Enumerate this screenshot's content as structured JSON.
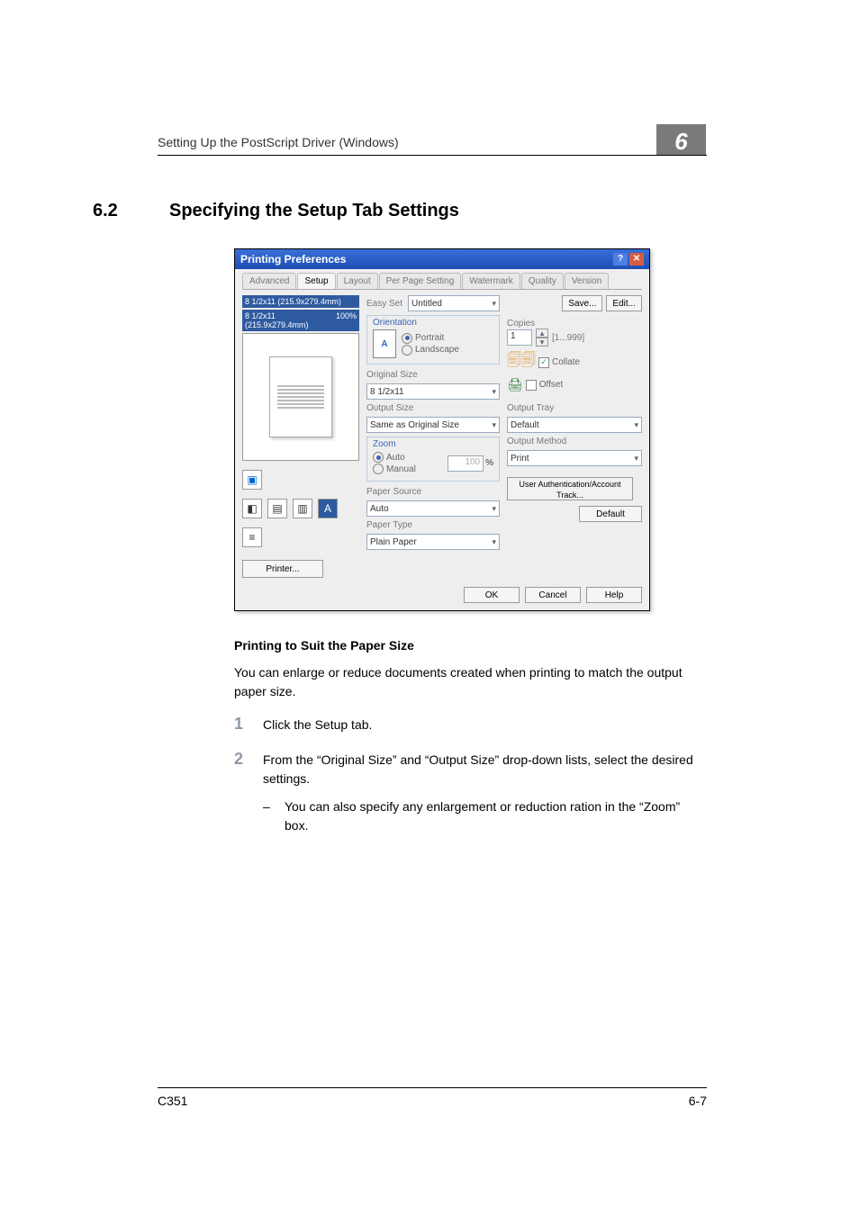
{
  "header": {
    "running": "Setting Up the PostScript Driver (Windows)",
    "chapter": "6"
  },
  "heading": {
    "number": "6.2",
    "title": "Specifying the Setup Tab Settings"
  },
  "dialog": {
    "title": "Printing Preferences",
    "tabs": [
      "Advanced",
      "Setup",
      "Layout",
      "Per Page Setting",
      "Watermark",
      "Quality",
      "Version"
    ],
    "active_tab": 1,
    "preview": {
      "line1": "8 1/2x11 (215.9x279.4mm)",
      "line2": "8 1/2x11 (215.9x279.4mm)",
      "scale": "100%"
    },
    "printer_btn": "Printer...",
    "easy_set": {
      "label": "Easy Set",
      "value": "Untitled",
      "save": "Save...",
      "edit": "Edit..."
    },
    "orientation": {
      "legend": "Orientation",
      "portrait": "Portrait",
      "landscape": "Landscape"
    },
    "original_size": {
      "label": "Original Size",
      "value": "8 1/2x11"
    },
    "output_size": {
      "label": "Output Size",
      "value": "Same as Original Size"
    },
    "zoom": {
      "legend": "Zoom",
      "auto": "Auto",
      "manual": "Manual",
      "value": "100",
      "pct": "%"
    },
    "paper_source": {
      "label": "Paper Source",
      "value": "Auto"
    },
    "paper_type": {
      "label": "Paper Type",
      "value": "Plain Paper"
    },
    "copies": {
      "label": "Copies",
      "value": "1",
      "range": "[1...999]"
    },
    "collate": "Collate",
    "offset": "Offset",
    "output_tray": {
      "label": "Output Tray",
      "value": "Default"
    },
    "output_method": {
      "label": "Output Method",
      "value": "Print"
    },
    "auth_btn": "User Authentication/Account Track...",
    "default_btn": "Default",
    "footer": {
      "ok": "OK",
      "cancel": "Cancel",
      "help": "Help"
    }
  },
  "bodytext": {
    "h3": "Printing to Suit the Paper Size",
    "p1": "You can enlarge or reduce documents created when printing to match the output paper size.",
    "steps": [
      "Click the Setup tab.",
      "From the “Original Size” and “Output Size” drop-down lists, select the desired settings."
    ],
    "sub": "You can also specify any enlargement or reduction ration in the “Zoom” box."
  },
  "footer": {
    "left": "C351",
    "right": "6-7"
  }
}
